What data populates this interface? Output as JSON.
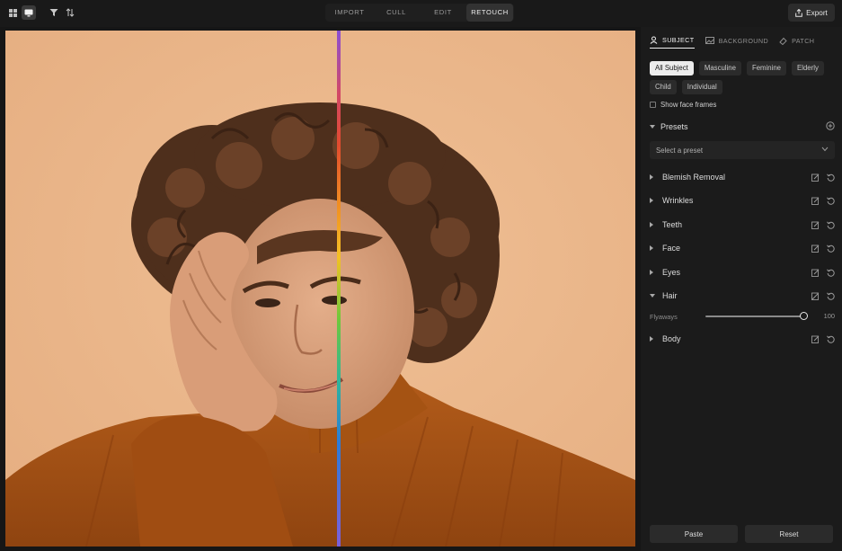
{
  "toolbar": {
    "grid_view_icon": "grid-icon",
    "single_view_icon": "monitor-icon",
    "filter_icon": "filter-icon",
    "sort_icon": "sort-icon",
    "export_label": "Export"
  },
  "mode_tabs": [
    {
      "label": "IMPORT",
      "active": false
    },
    {
      "label": "CULL",
      "active": false
    },
    {
      "label": "EDIT",
      "active": false
    },
    {
      "label": "RETOUCH",
      "active": true
    }
  ],
  "panel": {
    "tabs": [
      {
        "label": "SUBJECT",
        "icon": "person-icon",
        "active": true
      },
      {
        "label": "BACKGROUND",
        "icon": "image-icon",
        "active": false
      },
      {
        "label": "PATCH",
        "icon": "eraser-icon",
        "active": false
      }
    ],
    "subject_filters": [
      {
        "label": "All Subject",
        "active": true
      },
      {
        "label": "Masculine",
        "active": false
      },
      {
        "label": "Feminine",
        "active": false
      },
      {
        "label": "Elderly",
        "active": false
      },
      {
        "label": "Child",
        "active": false
      },
      {
        "label": "Individual",
        "active": false
      }
    ],
    "show_face_frames": "Show face frames",
    "presets_label": "Presets",
    "preset_placeholder": "Select a preset",
    "sections": [
      {
        "label": "Blemish Removal",
        "expanded": false
      },
      {
        "label": "Wrinkles",
        "expanded": false
      },
      {
        "label": "Teeth",
        "expanded": false
      },
      {
        "label": "Face",
        "expanded": false
      },
      {
        "label": "Eyes",
        "expanded": false
      },
      {
        "label": "Hair",
        "expanded": true
      },
      {
        "label": "Body",
        "expanded": false
      }
    ],
    "flyaways": {
      "label": "Flyaways",
      "value": "100"
    },
    "paste_label": "Paste",
    "reset_label": "Reset"
  },
  "colors": {
    "background": "#161616",
    "panel": "#1b1b1b",
    "photo_backdrop": "#e8b286",
    "sweater": "#a84f12"
  }
}
